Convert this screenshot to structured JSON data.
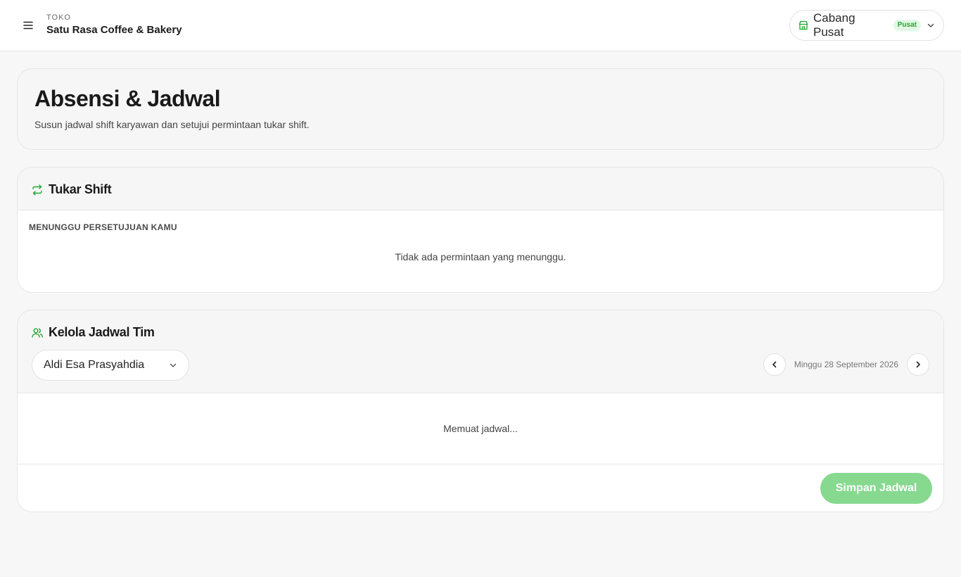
{
  "header": {
    "store_caption": "TOKO",
    "store_name": "Satu Rasa Coffee & Bakery",
    "branch_label": "Cabang Pusat",
    "branch_badge": "Pusat"
  },
  "icons": {
    "menu": "hamburger-icon",
    "branch": "store-icon",
    "dropdown": "chevron-down-icon",
    "swap": "swap-arrows-icon",
    "team": "users-icon",
    "prev": "chevron-left-icon",
    "next": "chevron-right-icon"
  },
  "colors": {
    "accent": "#22a534",
    "save_button": "#86d98f",
    "badge_bg": "#e3f7e5"
  },
  "page": {
    "title": "Absensi & Jadwal",
    "subtitle": "Susun jadwal shift karyawan dan setujui permintaan tukar shift."
  },
  "swap_section": {
    "title": "Tukar Shift",
    "caption": "MENUNGGU PERSETUJUAN KAMU",
    "empty_text": "Tidak ada permintaan yang menunggu."
  },
  "schedule_section": {
    "title": "Kelola Jadwal Tim",
    "employee_selected": "Aldi Esa Prasyahdia",
    "week_label": "Minggu 28 September 2026",
    "loading_text": "Memuat jadwal...",
    "save_label": "Simpan Jadwal"
  }
}
